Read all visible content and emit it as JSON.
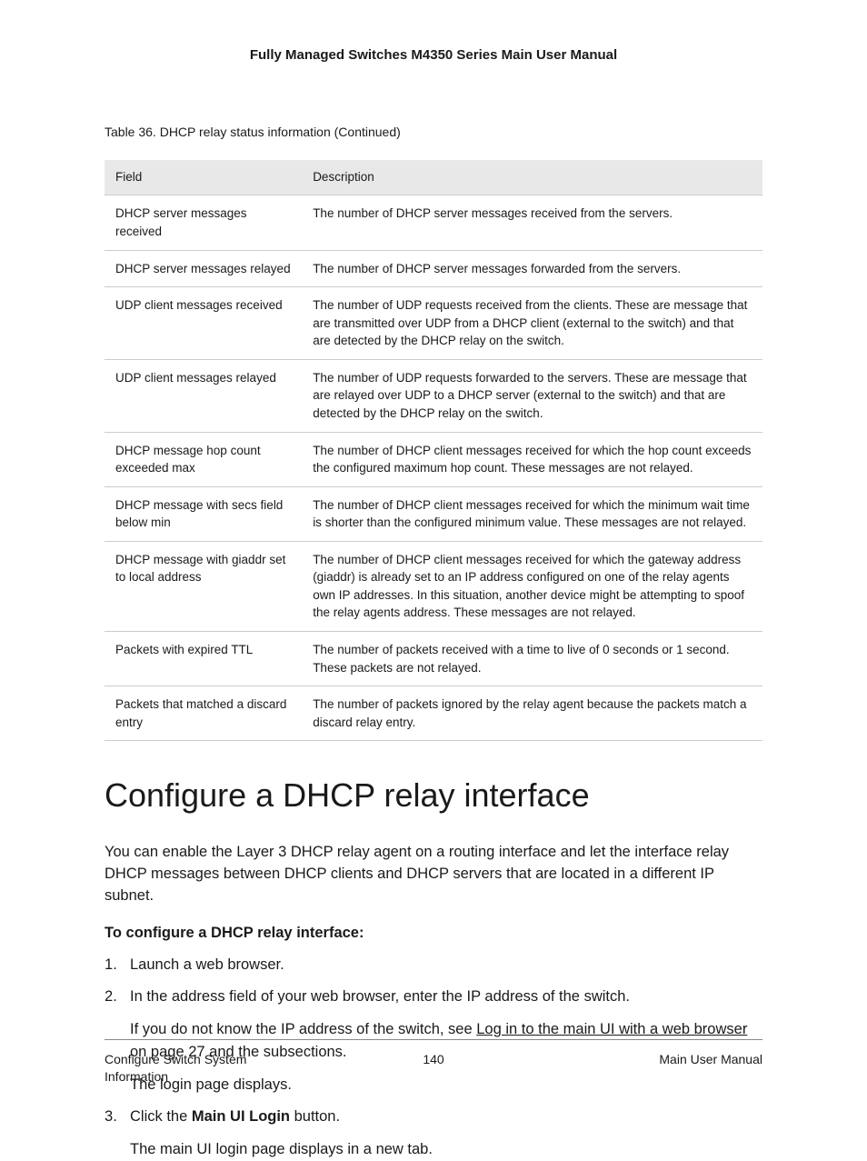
{
  "header": {
    "title": "Fully Managed Switches M4350 Series Main User Manual"
  },
  "table_caption": "Table 36. DHCP relay status information (Continued)",
  "table": {
    "headers": [
      "Field",
      "Description"
    ],
    "rows": [
      {
        "field": "DHCP server messages received",
        "description": "The number of DHCP server messages received from the servers."
      },
      {
        "field": "DHCP server messages relayed",
        "description": "The number of DHCP server messages forwarded from the servers."
      },
      {
        "field": "UDP client messages received",
        "description": "The number of UDP requests received from the clients. These are message that are transmitted over UDP from a DHCP client (external to the switch) and that are detected by the DHCP relay on the switch."
      },
      {
        "field": "UDP client messages relayed",
        "description": "The number of UDP requests forwarded to the servers. These are message that are relayed over UDP to a DHCP server (external to the switch) and that are detected by the DHCP relay on the switch."
      },
      {
        "field": "DHCP message hop count exceeded max",
        "description": "The number of DHCP client messages received for which the hop count exceeds the configured maximum hop count. These messages are not relayed."
      },
      {
        "field": "DHCP message with secs field below min",
        "description": "The number of DHCP client messages received for which the minimum wait time is shorter than the configured minimum value. These messages are not relayed."
      },
      {
        "field": "DHCP message with giaddr set to local address",
        "description": "The number of DHCP client messages received for which the gateway address (giaddr) is already set to an IP address configured on one of the relay agents own IP addresses. In this situation, another device might be attempting to spoof the relay agents address. These messages are not relayed."
      },
      {
        "field": "Packets with expired TTL",
        "description": "The number of packets received with a time to live of 0 seconds or 1 second. These packets are not relayed."
      },
      {
        "field": "Packets that matched a discard entry",
        "description": "The number of packets ignored by the relay agent because the packets match a discard relay entry."
      }
    ]
  },
  "section": {
    "heading": "Configure a DHCP relay interface",
    "intro": "You can enable the Layer 3 DHCP relay agent on a routing interface and let the interface relay DHCP messages between DHCP clients and DHCP servers that are located in a different IP subnet.",
    "sub_heading": "To configure a DHCP relay interface:",
    "steps": {
      "s1": "Launch a web browser.",
      "s2": "In the address field of your web browser, enter the IP address of the switch.",
      "s2_sub_prefix": "If you do not know the IP address of the switch, see ",
      "s2_sub_link": "Log in to the main UI with a web browser",
      "s2_sub_suffix": " on page 27 and the subsections.",
      "s2_sub2": "The login page displays.",
      "s3_prefix": "Click the ",
      "s3_bold": "Main UI Login",
      "s3_suffix": " button.",
      "s3_sub": "The main UI login page displays in a new tab."
    }
  },
  "footer": {
    "left": "Configure Switch System Information",
    "center": "140",
    "right": "Main User Manual"
  }
}
